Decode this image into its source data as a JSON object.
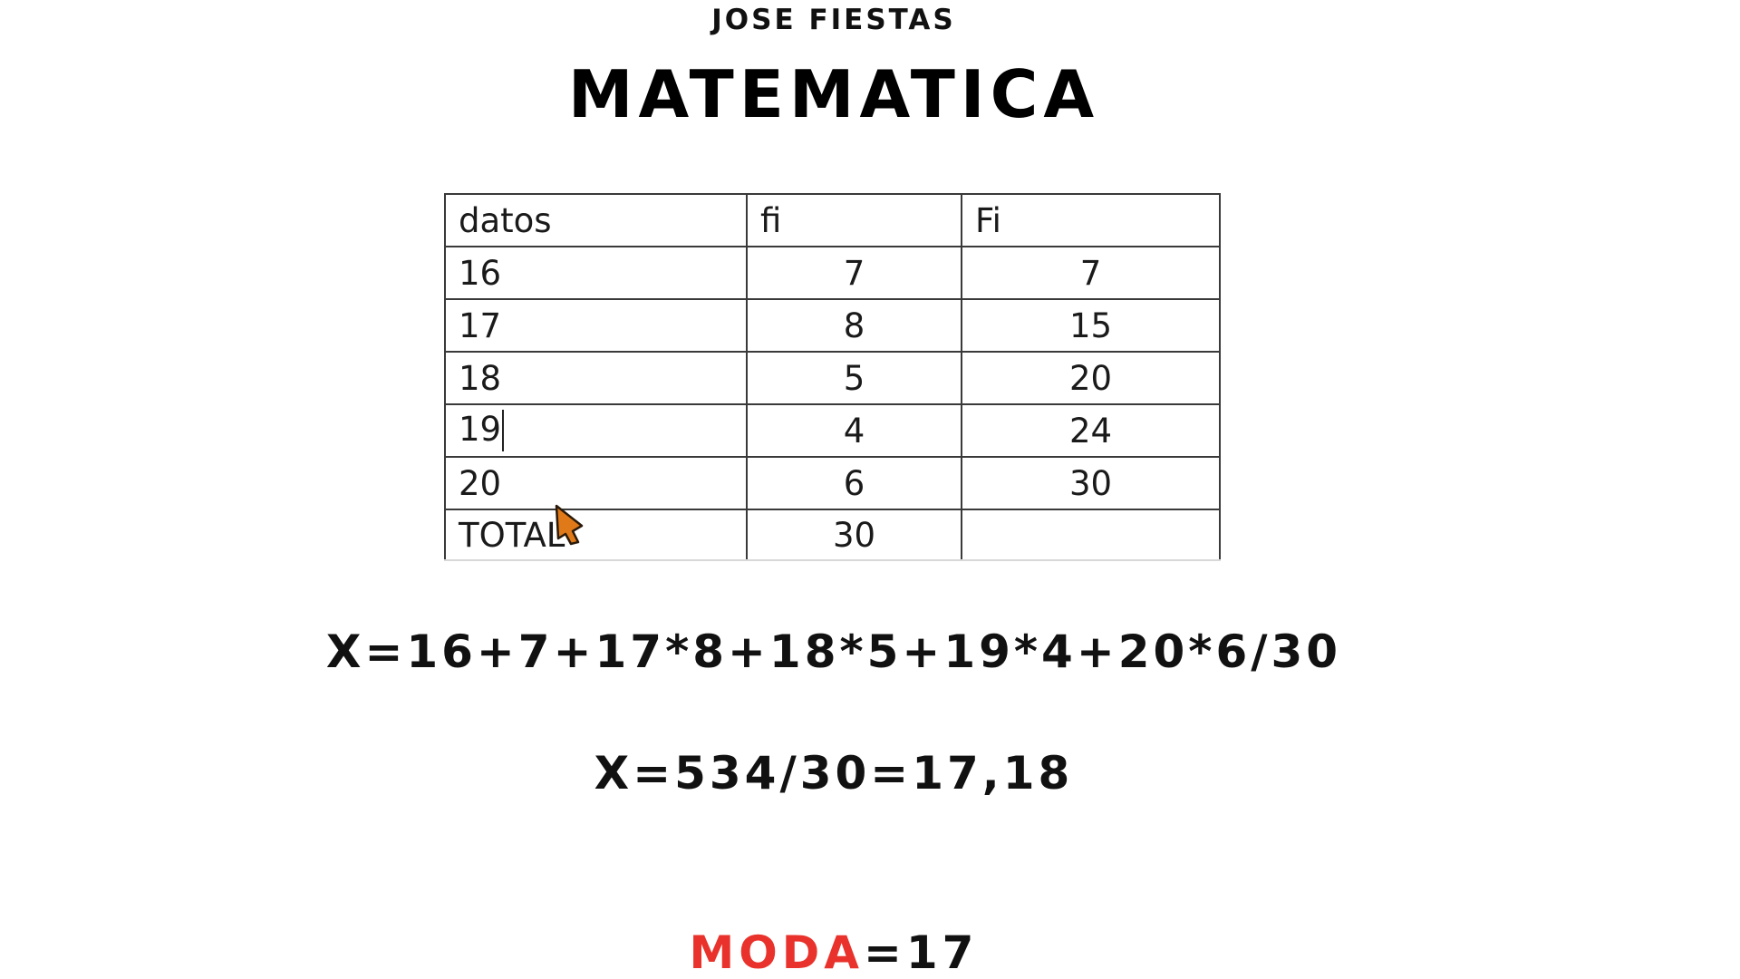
{
  "header": {
    "author": "JOSE FIESTAS",
    "title": "MATEMATICA"
  },
  "table": {
    "headers": [
      "datos",
      "fi",
      "Fi"
    ],
    "rows": [
      [
        "16",
        "7",
        "7"
      ],
      [
        "17",
        "8",
        "15"
      ],
      [
        "18",
        "5",
        "20"
      ],
      [
        "19",
        "4",
        "24"
      ],
      [
        "20",
        "6",
        "30"
      ],
      [
        "TOTAL",
        "30",
        ""
      ]
    ]
  },
  "formulas": {
    "mean_expression": "X=16+7+17*8+18*5+19*4+20*6/30",
    "mean_result": "X=534/30=17,18"
  },
  "mode": {
    "label": "MODA",
    "value": "=17"
  },
  "colors": {
    "accent": "#e8322b",
    "text": "#111111",
    "cursor_fill": "#e07a18"
  },
  "icons": {
    "cursor": "mouse-pointer-icon"
  }
}
